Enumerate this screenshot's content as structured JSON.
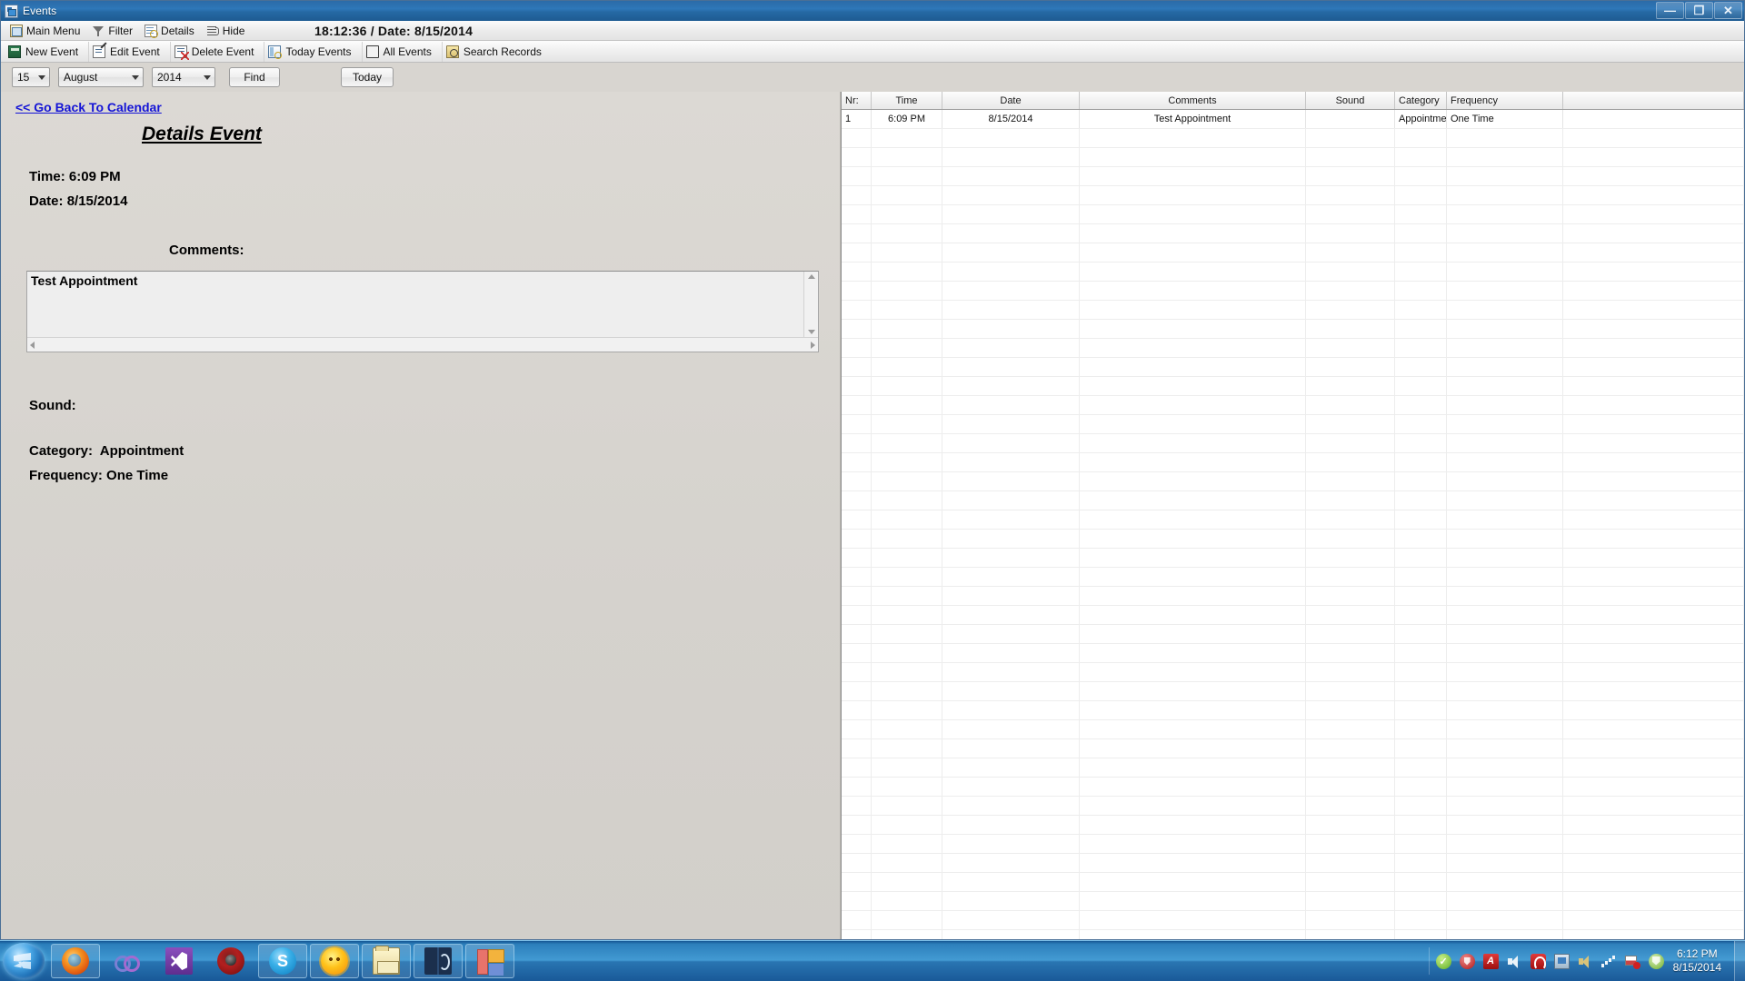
{
  "window": {
    "title": "Events",
    "icon": "calendar-window-icon",
    "controls": {
      "minimize": "—",
      "maximize": "❐",
      "close": "✕"
    }
  },
  "menubar": {
    "items": [
      {
        "label": "Main Menu",
        "icon": "main-menu-icon"
      },
      {
        "label": "Filter",
        "icon": "filter-funnel-icon"
      },
      {
        "label": "Details",
        "icon": "details-magnifier-icon"
      },
      {
        "label": "Hide",
        "icon": "hide-lines-icon"
      }
    ],
    "clock": "18:12:36 / Date: 8/15/2014"
  },
  "toolbar": {
    "items": [
      {
        "label": "New Event",
        "icon": "new-event-icon"
      },
      {
        "label": "Edit Event",
        "icon": "edit-event-icon"
      },
      {
        "label": "Delete Event",
        "icon": "delete-event-icon"
      },
      {
        "label": "Today Events",
        "icon": "today-events-icon"
      },
      {
        "label": "All Events",
        "icon": "all-events-icon"
      },
      {
        "label": "Search Records",
        "icon": "search-records-icon"
      }
    ]
  },
  "filterbar": {
    "day": "15",
    "month": "August",
    "year": "2014",
    "find_label": "Find",
    "today_label": "Today"
  },
  "details": {
    "back_link": "<< Go Back To Calendar",
    "heading": "Details Event",
    "time_label": "Time:",
    "time_value": "6:09 PM",
    "date_label": "Date:",
    "date_value": "8/15/2014",
    "comments_label": "Comments:",
    "comments_value": "Test Appointment",
    "sound_label": "Sound:",
    "sound_value": "",
    "category_label": "Category:",
    "category_value": "Appointment",
    "frequency_label": "Frequency:",
    "frequency_value": "One Time"
  },
  "grid": {
    "columns": [
      "Nr:",
      "Time",
      "Date",
      "Comments",
      "Sound",
      "Category",
      "Frequency",
      ""
    ],
    "rows": [
      {
        "nr": "1",
        "time": "6:09 PM",
        "date": "8/15/2014",
        "comments": "Test Appointment",
        "sound": "",
        "category": "Appointment",
        "frequency": "One Time"
      }
    ]
  },
  "taskbar": {
    "start": "start-orb",
    "apps": [
      {
        "name": "firefox",
        "icon": "firefox-icon"
      },
      {
        "name": "loop",
        "icon": "loop-icon"
      },
      {
        "name": "visual-studio",
        "icon": "visual-studio-icon"
      },
      {
        "name": "media-player",
        "icon": "media-player-icon"
      },
      {
        "name": "skype",
        "icon": "skype-icon"
      },
      {
        "name": "sun-app",
        "icon": "sun-icon"
      },
      {
        "name": "file-explorer",
        "icon": "folder-icon"
      },
      {
        "name": "book-app",
        "icon": "book-icon"
      },
      {
        "name": "events-app",
        "icon": "tiles-icon"
      }
    ],
    "tray_icons": [
      "green-check-icon",
      "red-circle-icon",
      "acrobat-icon",
      "volume-icon",
      "avira-icon",
      "network-screen-icon",
      "speaker-icon",
      "signal-bars-icon",
      "flag-alert-icon",
      "shield-icon"
    ],
    "clock_time": "6:12 PM",
    "clock_date": "8/15/2014"
  }
}
